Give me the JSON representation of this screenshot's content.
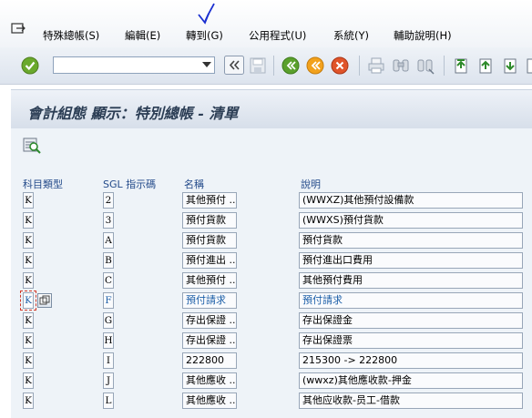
{
  "menu": {
    "items": [
      {
        "label": "特殊總帳(S)"
      },
      {
        "label": "編輯(E)"
      },
      {
        "label": "轉到(G)"
      },
      {
        "label": "公用程式(U)"
      },
      {
        "label": "系統(Y)"
      },
      {
        "label": "輔助說明(H)"
      }
    ]
  },
  "toolbar": {
    "command_value": "",
    "icons": [
      "enter-icon",
      "back-arrows-icon",
      "save-icon",
      "back-icon",
      "exit-icon",
      "cancel-icon",
      "print-icon",
      "find-icon",
      "find-next-icon",
      "first-page-icon",
      "previous-page-icon",
      "next-page-icon"
    ]
  },
  "page": {
    "title": "會計組態 顯示：特別總帳 - 清單"
  },
  "table": {
    "headers": {
      "type": "科目類型",
      "sgl": "SGL 指示碼",
      "name": "名稱",
      "desc": "說明"
    },
    "rows": [
      {
        "type": "K",
        "sgl": "2",
        "name": "其他預付 ..",
        "desc": "(WWXZ)其他預付設備款"
      },
      {
        "type": "K",
        "sgl": "3",
        "name": "預付貨款",
        "desc": "(WWXS)預付貨款"
      },
      {
        "type": "K",
        "sgl": "A",
        "name": "預付貨款",
        "desc": "預付貨款"
      },
      {
        "type": "K",
        "sgl": "B",
        "name": "預付進出 ..",
        "desc": "預付進出口費用"
      },
      {
        "type": "K",
        "sgl": "C",
        "name": "其他預付 ..",
        "desc": "其他預付費用"
      },
      {
        "type": "K",
        "sgl": "F",
        "name": "預付請求",
        "desc": "預付請求",
        "selected": true
      },
      {
        "type": "K",
        "sgl": "G",
        "name": "存出保證 ..",
        "desc": "存出保證金"
      },
      {
        "type": "K",
        "sgl": "H",
        "name": "存出保證 ..",
        "desc": "存出保證票"
      },
      {
        "type": "K",
        "sgl": "I",
        "name": "222800",
        "desc": "215300 -> 222800"
      },
      {
        "type": "K",
        "sgl": "J",
        "name": "其他應收 ..",
        "desc": "(wwxz)其他應收款-押金"
      },
      {
        "type": "K",
        "sgl": "L",
        "name": "其他應收 ..",
        "desc": "其他应收款-员工-借款"
      }
    ]
  }
}
